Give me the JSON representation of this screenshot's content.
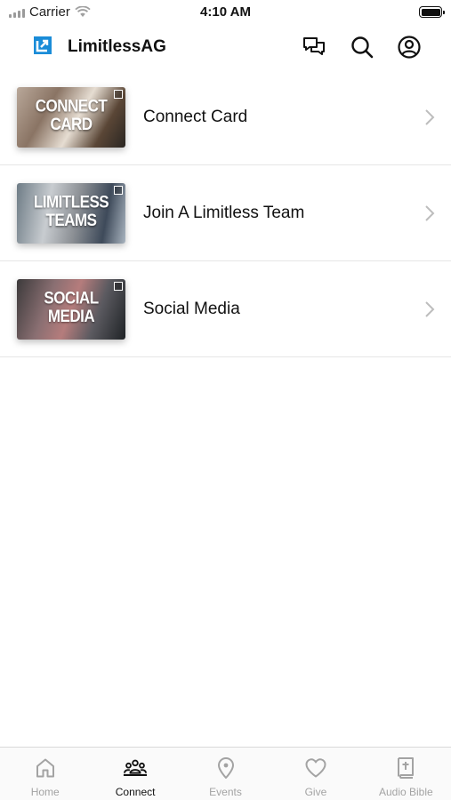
{
  "status_bar": {
    "carrier": "Carrier",
    "time": "4:10 AM"
  },
  "header": {
    "title": "LimitlessAG",
    "logo_color": "#1a8cd8",
    "icons": [
      "chat-icon",
      "search-icon",
      "profile-icon"
    ]
  },
  "items": [
    {
      "thumb_line1": "CONNECT",
      "thumb_line2": "CARD",
      "label": "Connect Card"
    },
    {
      "thumb_line1": "LIMITLESS",
      "thumb_line2": "TEAMS",
      "label": "Join A Limitless Team"
    },
    {
      "thumb_line1": "SOCIAL",
      "thumb_line2": "MEDIA",
      "label": "Social Media"
    }
  ],
  "tabs": [
    {
      "label": "Home",
      "icon": "home-icon",
      "active": false
    },
    {
      "label": "Connect",
      "icon": "people-icon",
      "active": true
    },
    {
      "label": "Events",
      "icon": "location-pin-icon",
      "active": false
    },
    {
      "label": "Give",
      "icon": "heart-icon",
      "active": false
    },
    {
      "label": "Audio Bible",
      "icon": "bible-icon",
      "active": false
    }
  ],
  "colors": {
    "active_tab": "#111111",
    "inactive_tab": "#a3a3a3",
    "divider": "#e6e6e6"
  }
}
